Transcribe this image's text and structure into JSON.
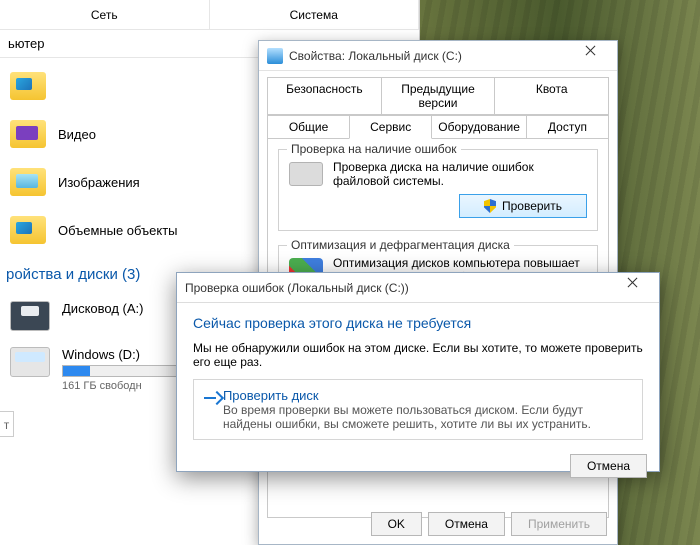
{
  "explorer": {
    "ribbon_tabs": [
      "Сеть",
      "Система"
    ],
    "header": "ьютер",
    "folders": [
      {
        "label": "",
        "icon": "3d"
      },
      {
        "label": "Видео",
        "icon": "video"
      },
      {
        "label": "Изображения",
        "icon": "pic"
      },
      {
        "label": "Объемные объекты",
        "icon": "3d"
      }
    ],
    "devices_header": "ройства и диски (3)",
    "drives": [
      {
        "name": "Дисковод (A:)",
        "type": "floppy"
      },
      {
        "name": "Windows (D:)",
        "type": "hdd",
        "free_text": "161 ГБ свободн",
        "fill_pct": 18
      }
    ]
  },
  "properties": {
    "title": "Свойства: Локальный диск (C:)",
    "tabs_row1": [
      "Безопасность",
      "Предыдущие версии",
      "Квота"
    ],
    "tabs_row2": [
      "Общие",
      "Сервис",
      "Оборудование",
      "Доступ"
    ],
    "active_tab": "Сервис",
    "group_check": {
      "title": "Проверка на наличие ошибок",
      "desc": "Проверка диска на наличие ошибок файловой системы.",
      "button": "Проверить"
    },
    "group_defrag": {
      "title": "Оптимизация и дефрагментация диска",
      "desc": "Оптимизация дисков компьютера повышает эффективность его работы"
    },
    "buttons": {
      "ok": "OK",
      "cancel": "Отмена",
      "apply": "Применить"
    }
  },
  "check_dialog": {
    "title": "Проверка ошибок (Локальный диск (C:))",
    "heading": "Сейчас проверка этого диска не требуется",
    "body": "Мы не обнаружили ошибок на этом диске. Если вы хотите, то можете проверить его еще раз.",
    "option_title": "Проверить диск",
    "option_sub": "Во время проверки вы можете пользоваться диском. Если будут найдены ошибки, вы сможете решить, хотите ли вы их устранить.",
    "cancel": "Отмена"
  }
}
